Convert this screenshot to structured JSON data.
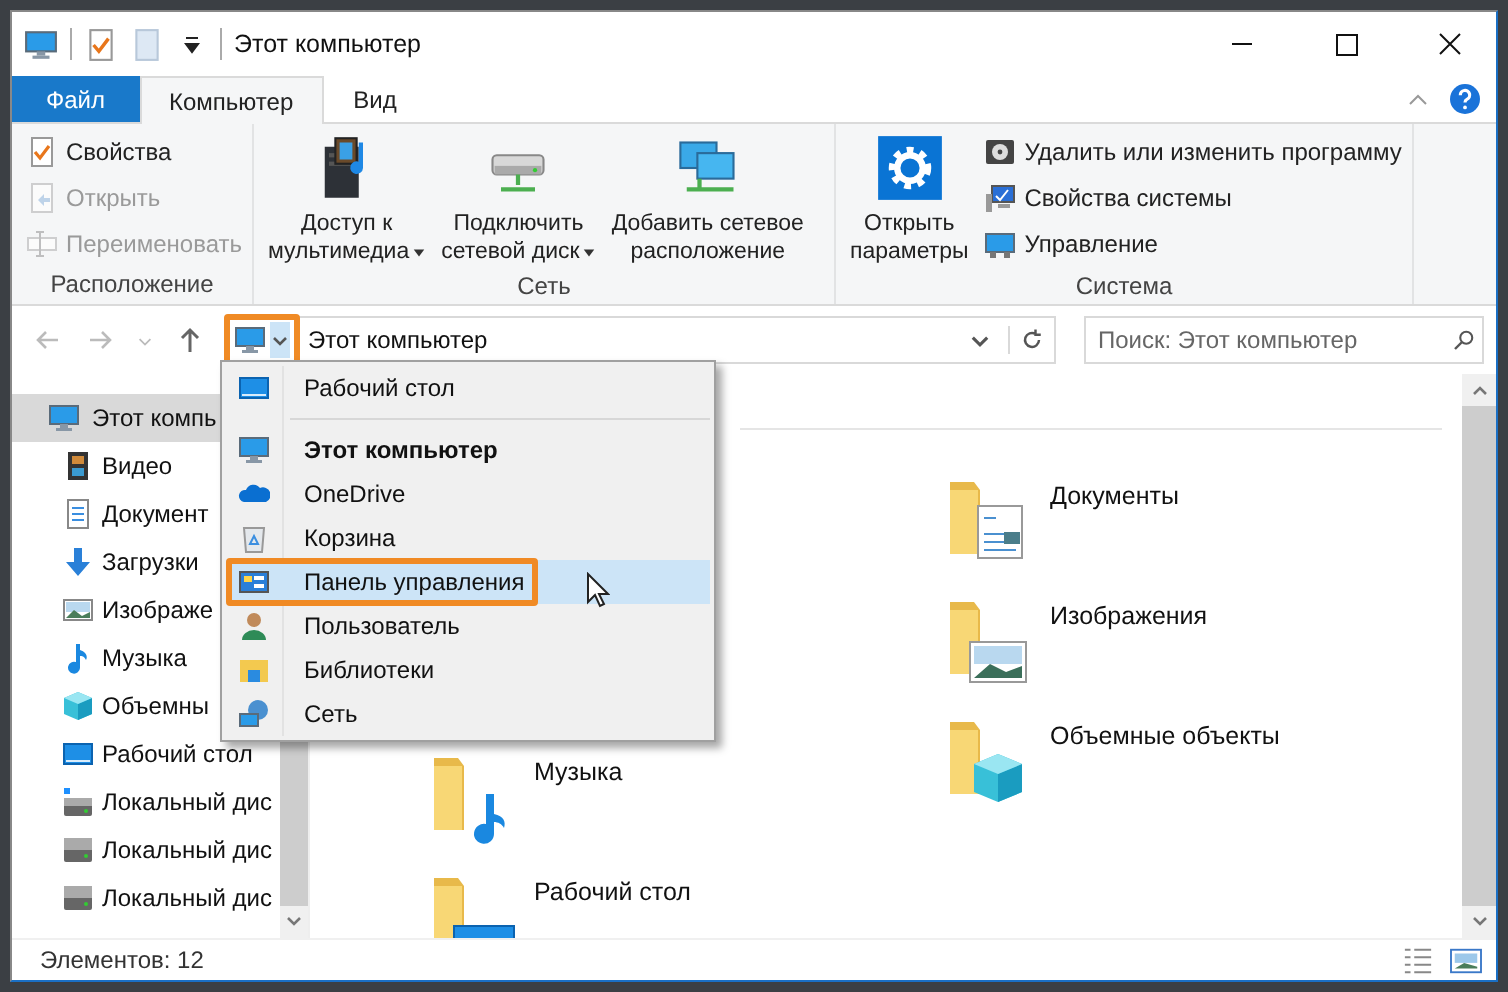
{
  "window": {
    "title": "Этот компьютер"
  },
  "ribbon": {
    "tabs": [
      {
        "label": "Файл",
        "kind": "file",
        "selected": false
      },
      {
        "label": "Компьютер",
        "kind": "tab",
        "selected": true
      },
      {
        "label": "Вид",
        "kind": "tab",
        "selected": false
      }
    ],
    "groups": [
      {
        "label": "Расположение",
        "items": [
          {
            "kind": "small",
            "lines": [
              "Свойства"
            ],
            "disabled": false
          },
          {
            "kind": "small",
            "lines": [
              "Открыть"
            ],
            "disabled": true
          },
          {
            "kind": "small",
            "lines": [
              "Переименовать"
            ],
            "disabled": true
          }
        ]
      },
      {
        "label": "Сеть",
        "items": [
          {
            "kind": "large",
            "lines": [
              "Доступ к",
              "мультимедиа"
            ],
            "dropdown": true
          },
          {
            "kind": "large",
            "lines": [
              "Подключить",
              "сетевой диск"
            ],
            "dropdown": true
          },
          {
            "kind": "large",
            "lines": [
              "Добавить сетевое",
              "расположение"
            ],
            "dropdown": false
          }
        ]
      },
      {
        "label": "Система",
        "items": [
          {
            "kind": "large",
            "lines": [
              "Открыть",
              "параметры"
            ],
            "dropdown": false
          },
          {
            "kind": "small",
            "lines": [
              "Удалить или изменить программу"
            ],
            "disabled": false
          },
          {
            "kind": "small",
            "lines": [
              "Свойства системы"
            ],
            "disabled": false
          },
          {
            "kind": "small",
            "lines": [
              "Управление"
            ],
            "disabled": false
          }
        ]
      }
    ]
  },
  "address": {
    "location": "Этот компьютер",
    "highlighted": true
  },
  "search": {
    "placeholder": "Поиск: Этот компьютер"
  },
  "nav": [
    {
      "label": "Этот компь",
      "selected": true,
      "children": [
        {
          "label": "Видео"
        },
        {
          "label": "Документ"
        },
        {
          "label": "Загрузки"
        },
        {
          "label": "Изображе"
        },
        {
          "label": "Музыка"
        },
        {
          "label": "Объемны"
        },
        {
          "label": "Рабочий стол"
        },
        {
          "label": "Локальный дис"
        },
        {
          "label": "Локальный дис"
        },
        {
          "label": "Локальный дис"
        }
      ]
    }
  ],
  "content": {
    "column_1": [
      {
        "label": "Музыка"
      },
      {
        "label": "Рабочий стол"
      }
    ],
    "column_2": [
      {
        "label": "Документы"
      },
      {
        "label": "Изображения"
      },
      {
        "label": "Объемные объекты"
      }
    ]
  },
  "menu": {
    "items": [
      {
        "label": "Рабочий стол",
        "current": false,
        "selected": false,
        "divider_after": true
      },
      {
        "label": "Этот компьютер",
        "current": true,
        "selected": false,
        "divider_after": false
      },
      {
        "label": "OneDrive",
        "current": false,
        "selected": false,
        "divider_after": false
      },
      {
        "label": "Корзина",
        "current": false,
        "selected": false,
        "divider_after": false
      },
      {
        "label": "Панель управления",
        "current": false,
        "selected": true,
        "divider_after": false
      },
      {
        "label": "Пользователь",
        "current": false,
        "selected": false,
        "divider_after": false
      },
      {
        "label": "Библиотеки",
        "current": false,
        "selected": false,
        "divider_after": false
      },
      {
        "label": "Сеть",
        "current": false,
        "selected": false,
        "divider_after": false
      }
    ]
  },
  "status_bar": {
    "count": "Элементов: 12"
  }
}
